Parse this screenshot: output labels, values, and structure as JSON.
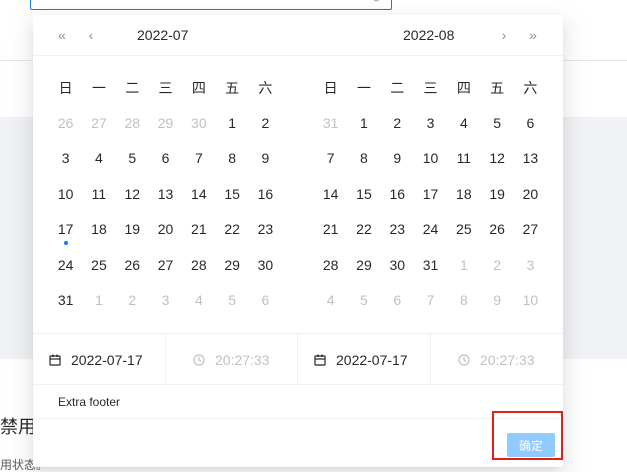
{
  "background": {
    "heading_fragment": "禁用",
    "desc_fragment": "用状态。",
    "clear_icon": "close-circle-icon"
  },
  "picker": {
    "left_panel": {
      "super_prev": "«",
      "prev": "‹",
      "title": "2022-07",
      "weekdays": [
        "日",
        "一",
        "二",
        "三",
        "四",
        "五",
        "六"
      ],
      "weeks": [
        [
          {
            "d": "26",
            "out": true
          },
          {
            "d": "27",
            "out": true
          },
          {
            "d": "28",
            "out": true
          },
          {
            "d": "29",
            "out": true
          },
          {
            "d": "30",
            "out": true
          },
          {
            "d": "1",
            "out": false
          },
          {
            "d": "2",
            "out": false
          }
        ],
        [
          {
            "d": "3",
            "out": false
          },
          {
            "d": "4",
            "out": false
          },
          {
            "d": "5",
            "out": false
          },
          {
            "d": "6",
            "out": false
          },
          {
            "d": "7",
            "out": false
          },
          {
            "d": "8",
            "out": false
          },
          {
            "d": "9",
            "out": false
          }
        ],
        [
          {
            "d": "10",
            "out": false
          },
          {
            "d": "11",
            "out": false
          },
          {
            "d": "12",
            "out": false
          },
          {
            "d": "13",
            "out": false
          },
          {
            "d": "14",
            "out": false
          },
          {
            "d": "15",
            "out": false
          },
          {
            "d": "16",
            "out": false
          }
        ],
        [
          {
            "d": "17",
            "out": false,
            "today": true
          },
          {
            "d": "18",
            "out": false
          },
          {
            "d": "19",
            "out": false
          },
          {
            "d": "20",
            "out": false
          },
          {
            "d": "21",
            "out": false
          },
          {
            "d": "22",
            "out": false
          },
          {
            "d": "23",
            "out": false
          }
        ],
        [
          {
            "d": "24",
            "out": false
          },
          {
            "d": "25",
            "out": false
          },
          {
            "d": "26",
            "out": false
          },
          {
            "d": "27",
            "out": false
          },
          {
            "d": "28",
            "out": false
          },
          {
            "d": "29",
            "out": false
          },
          {
            "d": "30",
            "out": false
          }
        ],
        [
          {
            "d": "31",
            "out": false
          },
          {
            "d": "1",
            "out": true
          },
          {
            "d": "2",
            "out": true
          },
          {
            "d": "3",
            "out": true
          },
          {
            "d": "4",
            "out": true
          },
          {
            "d": "5",
            "out": true
          },
          {
            "d": "6",
            "out": true
          }
        ]
      ]
    },
    "right_panel": {
      "title": "2022-08",
      "next": "›",
      "super_next": "»",
      "weekdays": [
        "日",
        "一",
        "二",
        "三",
        "四",
        "五",
        "六"
      ],
      "weeks": [
        [
          {
            "d": "31",
            "out": true
          },
          {
            "d": "1",
            "out": false
          },
          {
            "d": "2",
            "out": false
          },
          {
            "d": "3",
            "out": false
          },
          {
            "d": "4",
            "out": false
          },
          {
            "d": "5",
            "out": false
          },
          {
            "d": "6",
            "out": false
          }
        ],
        [
          {
            "d": "7",
            "out": false
          },
          {
            "d": "8",
            "out": false
          },
          {
            "d": "9",
            "out": false
          },
          {
            "d": "10",
            "out": false
          },
          {
            "d": "11",
            "out": false
          },
          {
            "d": "12",
            "out": false
          },
          {
            "d": "13",
            "out": false
          }
        ],
        [
          {
            "d": "14",
            "out": false
          },
          {
            "d": "15",
            "out": false
          },
          {
            "d": "16",
            "out": false
          },
          {
            "d": "17",
            "out": false
          },
          {
            "d": "18",
            "out": false
          },
          {
            "d": "19",
            "out": false
          },
          {
            "d": "20",
            "out": false
          }
        ],
        [
          {
            "d": "21",
            "out": false
          },
          {
            "d": "22",
            "out": false
          },
          {
            "d": "23",
            "out": false
          },
          {
            "d": "24",
            "out": false
          },
          {
            "d": "25",
            "out": false
          },
          {
            "d": "26",
            "out": false
          },
          {
            "d": "27",
            "out": false
          }
        ],
        [
          {
            "d": "28",
            "out": false
          },
          {
            "d": "29",
            "out": false
          },
          {
            "d": "30",
            "out": false
          },
          {
            "d": "31",
            "out": false
          },
          {
            "d": "1",
            "out": true
          },
          {
            "d": "2",
            "out": true
          },
          {
            "d": "3",
            "out": true
          }
        ],
        [
          {
            "d": "4",
            "out": true
          },
          {
            "d": "5",
            "out": true
          },
          {
            "d": "6",
            "out": true
          },
          {
            "d": "7",
            "out": true
          },
          {
            "d": "8",
            "out": true
          },
          {
            "d": "9",
            "out": true
          },
          {
            "d": "10",
            "out": true
          }
        ]
      ]
    },
    "start_date": "2022-07-17",
    "start_time": "20:27:33",
    "end_date": "2022-07-17",
    "end_time": "20:27:33",
    "extra_footer": "Extra footer",
    "ok_label": "确定"
  },
  "colors": {
    "accent": "#1677ff",
    "ok_button_bg": "#91caff",
    "highlight_border": "#e0201a",
    "page_gray": "#f0f2f5"
  }
}
